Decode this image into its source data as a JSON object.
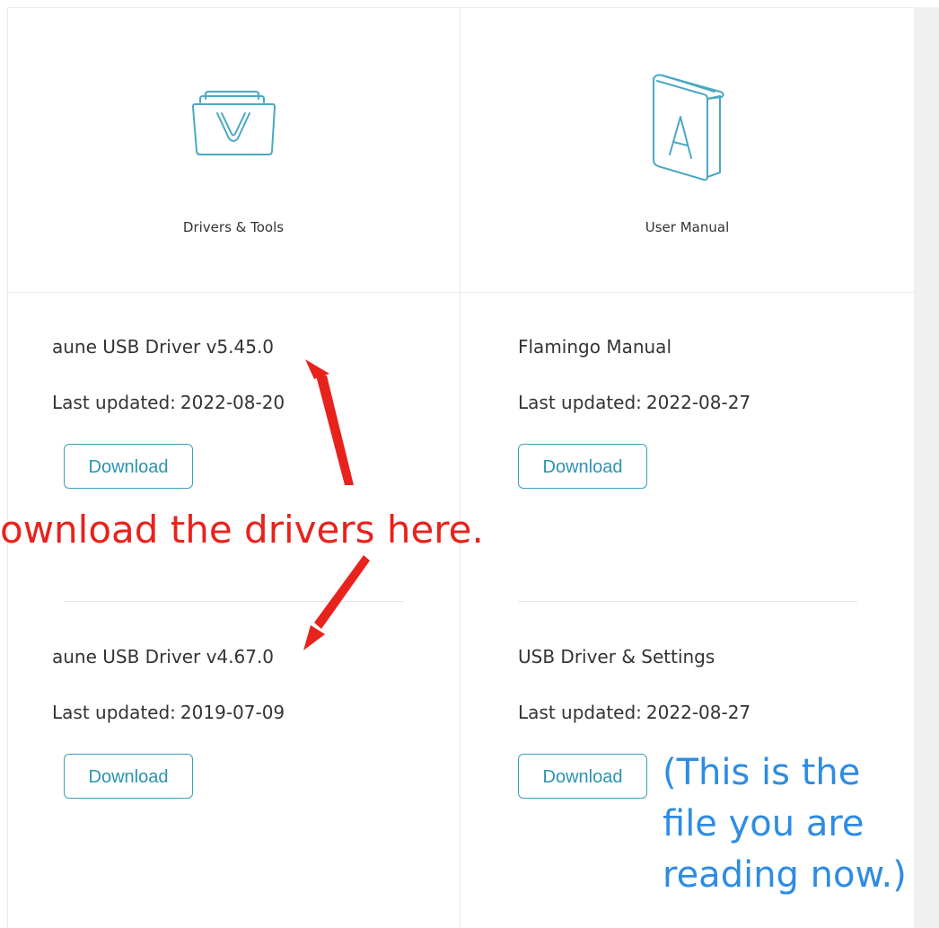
{
  "categories": [
    {
      "label": "Drivers & Tools",
      "icon": "folder-download-icon"
    },
    {
      "label": "User Manual",
      "icon": "book-manual-icon"
    }
  ],
  "drivers": [
    {
      "title": "aune USB Driver v5.45.0",
      "updated_label": "Last updated:",
      "updated_date": "2022-08-20",
      "button": "Download"
    },
    {
      "title": "aune USB Driver v4.67.0",
      "updated_label": "Last updated:",
      "updated_date": "2019-07-09",
      "button": "Download"
    }
  ],
  "manuals": [
    {
      "title": "Flamingo Manual",
      "updated_label": "Last updated:",
      "updated_date": "2022-08-27",
      "button": "Download"
    },
    {
      "title": "USB Driver & Settings",
      "updated_label": "Last updated:",
      "updated_date": "2022-08-27",
      "button": "Download"
    }
  ],
  "annotations": {
    "red_text": "ownload the drivers here.",
    "blue_lines": [
      "(This is the",
      "file you are",
      "reading now.)"
    ]
  },
  "colors": {
    "accent": "#3aa0ba",
    "annotation_red": "#e8221c",
    "annotation_blue": "#2e8ce3",
    "divider": "#e9e9e9",
    "gutter": "#f0f0f0"
  }
}
